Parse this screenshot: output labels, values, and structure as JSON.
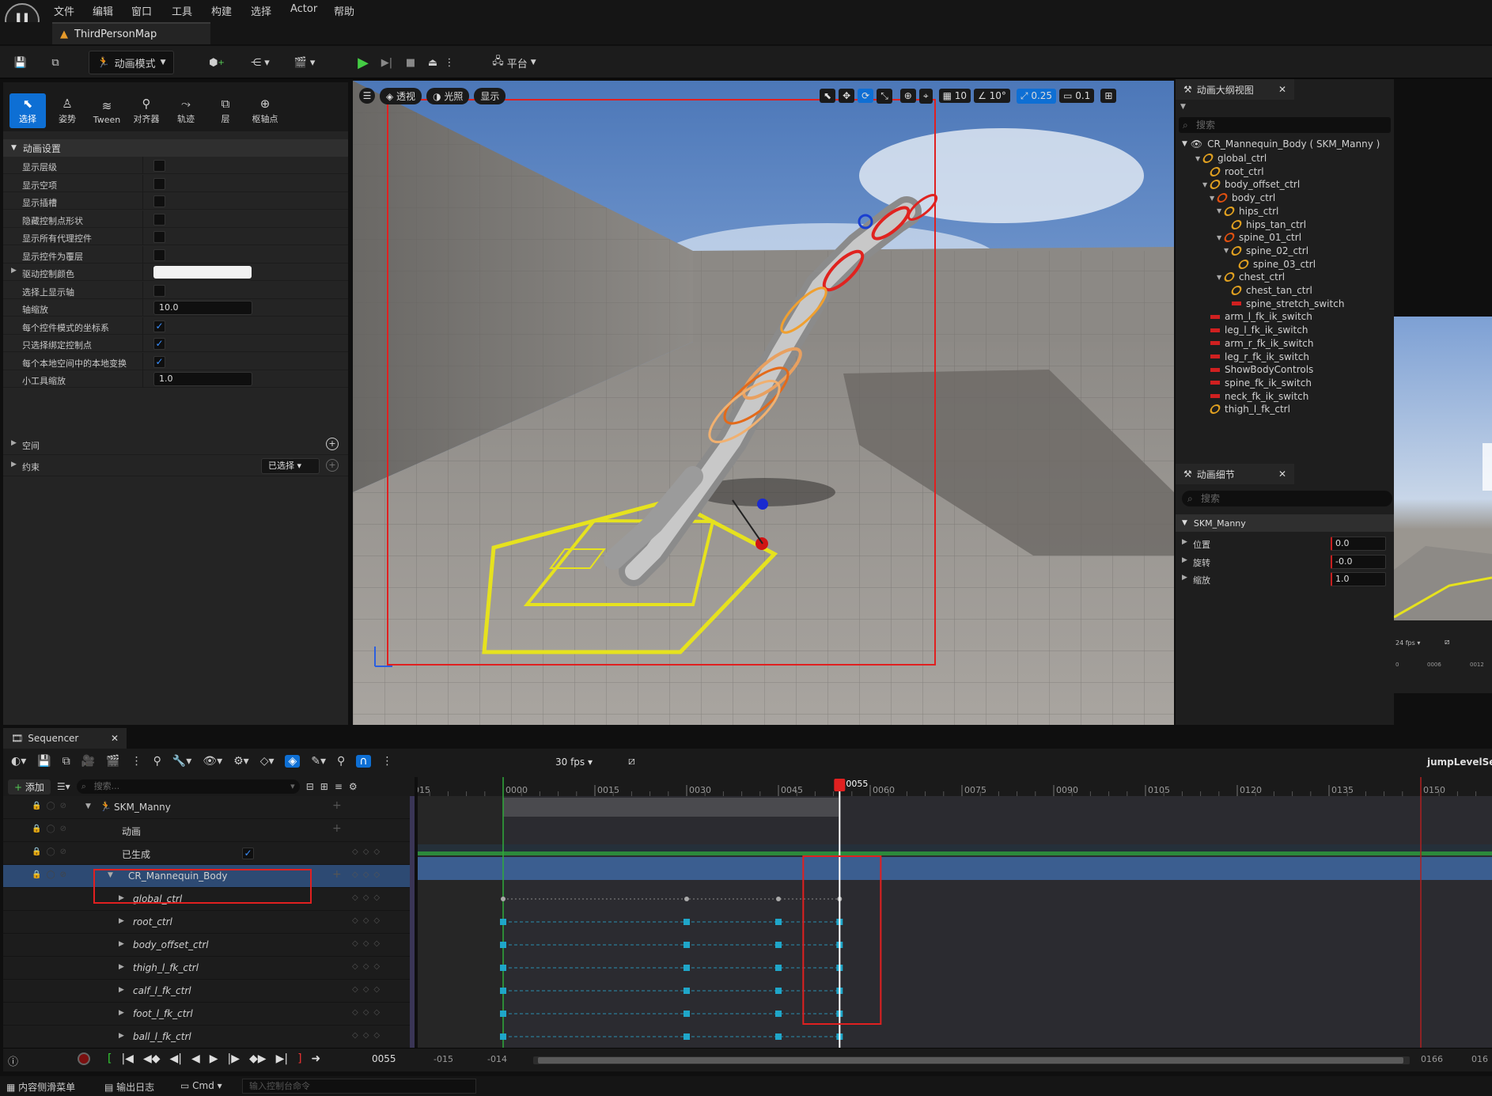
{
  "menu": [
    "文件",
    "编辑",
    "窗口",
    "工具",
    "构建",
    "选择",
    "Actor",
    "帮助"
  ],
  "map_tab": "ThirdPersonMap",
  "toolbar": {
    "mode_label": "动画模式",
    "platform_label": "平台"
  },
  "modes": [
    {
      "label": "选择",
      "icon": "⬉"
    },
    {
      "label": "姿势",
      "icon": "♙"
    },
    {
      "label": "Tween",
      "icon": "≋"
    },
    {
      "label": "对齐器",
      "icon": "⚲"
    },
    {
      "label": "轨迹",
      "icon": "⤳"
    },
    {
      "label": "层",
      "icon": "⧉"
    },
    {
      "label": "枢轴点",
      "icon": "⊕"
    }
  ],
  "anim_settings": {
    "header": "动画设置",
    "rows": [
      {
        "label": "显示层级",
        "type": "check",
        "checked": false
      },
      {
        "label": "显示空项",
        "type": "check",
        "checked": false
      },
      {
        "label": "显示插槽",
        "type": "check",
        "checked": false
      },
      {
        "label": "隐藏控制点形状",
        "type": "check",
        "checked": false
      },
      {
        "label": "显示所有代理控件",
        "type": "check",
        "checked": false
      },
      {
        "label": "显示控件为覆层",
        "type": "check",
        "checked": false
      },
      {
        "label": "驱动控制颜色",
        "type": "color"
      },
      {
        "label": "选择上显示轴",
        "type": "check",
        "checked": false
      },
      {
        "label": "轴缩放",
        "type": "num",
        "value": "10.0"
      },
      {
        "label": "每个控件模式的坐标系",
        "type": "check",
        "checked": true
      },
      {
        "label": "只选择绑定控制点",
        "type": "check",
        "checked": true
      },
      {
        "label": "每个本地空间中的本地变换",
        "type": "check",
        "checked": true
      },
      {
        "label": "小工具缩放",
        "type": "num",
        "value": "1.0"
      }
    ],
    "space_label": "空间",
    "constraint_label": "约束",
    "constraint_value": "已选择"
  },
  "viewport": {
    "view_label": "透视",
    "lit_label": "光照",
    "show_label": "显示",
    "grid_value": "10",
    "angle_value": "10°",
    "scale_value": "0.25",
    "camera_value": "0.1"
  },
  "outliner": {
    "title": "动画大纲视图",
    "search_placeholder": "搜索",
    "root": "CR_Mannequin_Body ( SKM_Manny )",
    "items": [
      {
        "label": "global_ctrl",
        "indent": 1,
        "kind": "bone",
        "exp": "▼"
      },
      {
        "label": "root_ctrl",
        "indent": 2,
        "kind": "bone",
        "exp": ""
      },
      {
        "label": "body_offset_ctrl",
        "indent": 2,
        "kind": "bone",
        "exp": "▼"
      },
      {
        "label": "body_ctrl",
        "indent": 3,
        "kind": "bone-o",
        "exp": "▼"
      },
      {
        "label": "hips_ctrl",
        "indent": 4,
        "kind": "bone",
        "exp": "▼"
      },
      {
        "label": "hips_tan_ctrl",
        "indent": 5,
        "kind": "bone",
        "exp": ""
      },
      {
        "label": "spine_01_ctrl",
        "indent": 4,
        "kind": "bone-o",
        "exp": "▼"
      },
      {
        "label": "spine_02_ctrl",
        "indent": 5,
        "kind": "bone",
        "exp": "▼"
      },
      {
        "label": "spine_03_ctrl",
        "indent": 6,
        "kind": "bone",
        "exp": ""
      },
      {
        "label": "chest_ctrl",
        "indent": 4,
        "kind": "bone",
        "exp": "▼"
      },
      {
        "label": "chest_tan_ctrl",
        "indent": 5,
        "kind": "bone",
        "exp": ""
      },
      {
        "label": "spine_stretch_switch",
        "indent": 5,
        "kind": "sw",
        "exp": ""
      },
      {
        "label": "arm_l_fk_ik_switch",
        "indent": 2,
        "kind": "sw",
        "exp": ""
      },
      {
        "label": "leg_l_fk_ik_switch",
        "indent": 2,
        "kind": "sw",
        "exp": ""
      },
      {
        "label": "arm_r_fk_ik_switch",
        "indent": 2,
        "kind": "sw",
        "exp": ""
      },
      {
        "label": "leg_r_fk_ik_switch",
        "indent": 2,
        "kind": "sw",
        "exp": ""
      },
      {
        "label": "ShowBodyControls",
        "indent": 2,
        "kind": "sw",
        "exp": ""
      },
      {
        "label": "spine_fk_ik_switch",
        "indent": 2,
        "kind": "sw",
        "exp": ""
      },
      {
        "label": "neck_fk_ik_switch",
        "indent": 2,
        "kind": "sw",
        "exp": ""
      },
      {
        "label": "thigh_l_fk_ctrl",
        "indent": 2,
        "kind": "bone",
        "exp": ""
      }
    ]
  },
  "details": {
    "title": "动画细节",
    "search_placeholder": "搜索",
    "section": "SKM_Manny",
    "rows": [
      {
        "label": "位置",
        "value": "0.0"
      },
      {
        "label": "旋转",
        "value": "-0.0"
      },
      {
        "label": "缩放",
        "value": "1.0"
      }
    ]
  },
  "thumb": {
    "fps": "24 fps",
    "ticks": [
      "0",
      "0006",
      "0012"
    ]
  },
  "sequencer": {
    "tab": "Sequencer",
    "fps": "30 fps",
    "sequence_name": "jumpLevelSeq",
    "add_label": "添加",
    "search_placeholder": "搜索...",
    "playhead": "0055",
    "current_frame": "0055",
    "ruler_ticks": [
      "015",
      "0000",
      "0015",
      "0030",
      "0045",
      "0060",
      "0075",
      "0090",
      "0105",
      "0120",
      "0135",
      "0150"
    ],
    "tracks": [
      {
        "label": "SKM_Manny",
        "level": 0,
        "italic": false
      },
      {
        "label": "动画",
        "level": 1,
        "italic": false
      },
      {
        "label": "已生成",
        "level": 1,
        "italic": false
      },
      {
        "label": "CR_Mannequin_Body",
        "level": 1,
        "italic": false
      },
      {
        "label": "global_ctrl",
        "level": 2,
        "italic": true
      },
      {
        "label": "root_ctrl",
        "level": 2,
        "italic": true
      },
      {
        "label": "body_offset_ctrl",
        "level": 2,
        "italic": true
      },
      {
        "label": "thigh_l_fk_ctrl",
        "level": 2,
        "italic": true
      },
      {
        "label": "calf_l_fk_ctrl",
        "level": 2,
        "italic": true
      },
      {
        "label": "foot_l_fk_ctrl",
        "level": 2,
        "italic": true
      },
      {
        "label": "ball_l_fk_ctrl",
        "level": 2,
        "italic": true
      }
    ],
    "keyframes": [
      0,
      30,
      45,
      55
    ],
    "range_start": "-015",
    "range_start2": "-014",
    "range_end": "0166",
    "range_end2": "016"
  },
  "status": {
    "content_drawer": "内容侧滑菜单",
    "output_log": "输出日志",
    "cmd": "Cmd",
    "cmd_placeholder": "输入控制台命令"
  }
}
